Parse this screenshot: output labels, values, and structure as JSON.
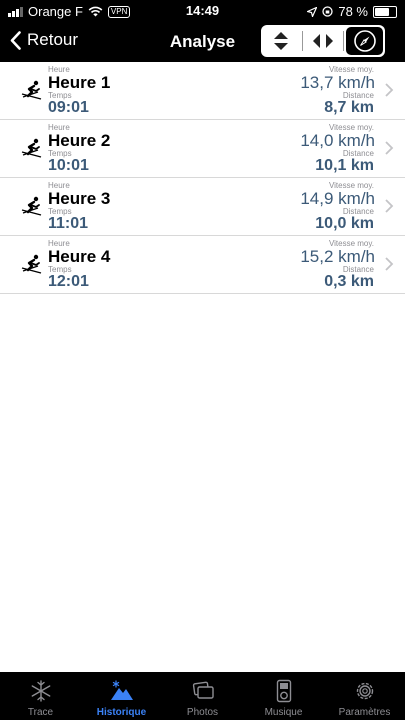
{
  "status_bar": {
    "carrier": "Orange F",
    "vpn": "VPN",
    "time": "14:49",
    "battery": "78 %",
    "battery_level": 0.78
  },
  "nav": {
    "back_label": "Retour",
    "title": "Analyse"
  },
  "segments": [
    {
      "icon": "sort-vertical-icon",
      "active": false
    },
    {
      "icon": "split-horizontal-icon",
      "active": false
    },
    {
      "icon": "compass-icon",
      "active": true
    }
  ],
  "labels": {
    "heure": "Heure",
    "temps": "Temps",
    "vitesse": "Vitesse moy.",
    "distance": "Distance"
  },
  "rows": [
    {
      "title": "Heure 1",
      "time": "09:01",
      "speed": "13,7 km/h",
      "distance": "8,7 km"
    },
    {
      "title": "Heure 2",
      "time": "10:01",
      "speed": "14,0 km/h",
      "distance": "10,1 km"
    },
    {
      "title": "Heure 3",
      "time": "11:01",
      "speed": "14,9 km/h",
      "distance": "10,0 km"
    },
    {
      "title": "Heure 4",
      "time": "12:01",
      "speed": "15,2 km/h",
      "distance": "0,3 km"
    }
  ],
  "tabs": [
    {
      "label": "Trace",
      "icon": "snowflake-icon",
      "active": false
    },
    {
      "label": "Historique",
      "icon": "mountain-icon",
      "active": true
    },
    {
      "label": "Photos",
      "icon": "photos-icon",
      "active": false
    },
    {
      "label": "Musique",
      "icon": "music-player-icon",
      "active": false
    },
    {
      "label": "Paramètres",
      "icon": "gear-icon",
      "active": false
    }
  ],
  "colors": {
    "accent": "#3b82f6",
    "value_blue": "#3c5a78",
    "bar_bg": "#000000"
  }
}
